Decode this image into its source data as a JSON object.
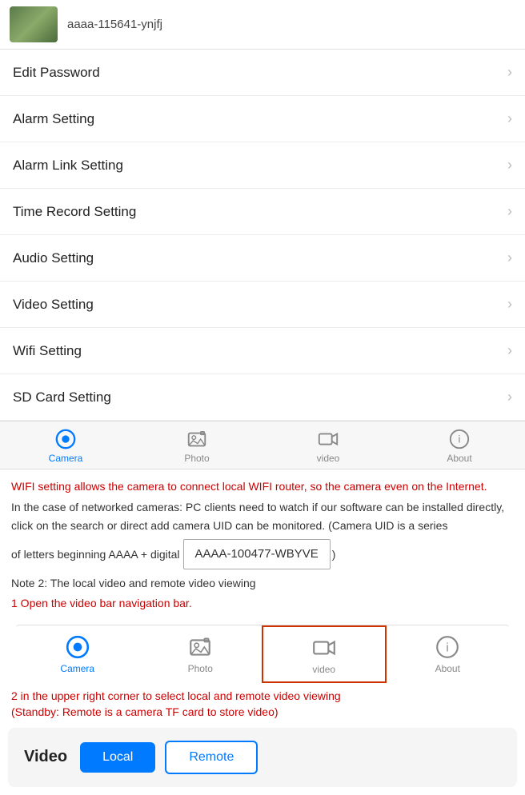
{
  "device": {
    "name": "aaaa-115641-ynjfj"
  },
  "menu": {
    "items": [
      {
        "id": "edit-password",
        "label": "Edit Password"
      },
      {
        "id": "alarm-setting",
        "label": "Alarm Setting"
      },
      {
        "id": "alarm-link-setting",
        "label": "Alarm Link Setting"
      },
      {
        "id": "time-record-setting",
        "label": "Time Record Setting"
      },
      {
        "id": "audio-setting",
        "label": "Audio Setting"
      },
      {
        "id": "video-setting",
        "label": "Video Setting"
      },
      {
        "id": "wifi-setting",
        "label": "Wifi Setting"
      },
      {
        "id": "sd-card-setting",
        "label": "SD Card Setting"
      }
    ]
  },
  "tabBar1": {
    "items": [
      {
        "id": "camera",
        "label": "Camera",
        "active": true
      },
      {
        "id": "photo",
        "label": "Photo",
        "active": false
      },
      {
        "id": "video",
        "label": "video",
        "active": false
      },
      {
        "id": "about",
        "label": "About",
        "active": false
      }
    ]
  },
  "infoSection": {
    "redLine1": "WIFI setting allows the camera to connect local WIFI router, so the camera even on the Internet.",
    "line2": "In the case of networked cameras: PC clients need to watch if our software can be installed directly, click on the search or direct add camera UID can be monitored. (Camera UID is a series",
    "line3": "of letters beginning AAAA + digital",
    "uid": "AAAA-100477-WBYVE",
    "suffix": ")",
    "line4": "Note 2: The local video and remote video viewing",
    "redLine2": "1 Open the video bar navigation bar."
  },
  "tabBar2": {
    "items": [
      {
        "id": "camera2",
        "label": "Camera",
        "active": true
      },
      {
        "id": "photo2",
        "label": "Photo",
        "active": false
      },
      {
        "id": "video2",
        "label": "video",
        "active": false,
        "highlighted": true
      },
      {
        "id": "about2",
        "label": "About",
        "active": false
      }
    ]
  },
  "note2": {
    "redLine3": "2 in the upper right corner to select local and remote video viewing",
    "redLine4": "(Standby: Remote is a camera TF card to store video)"
  },
  "videoButtons": {
    "label": "Video",
    "localLabel": "Local",
    "remoteLabel": "Remote"
  }
}
